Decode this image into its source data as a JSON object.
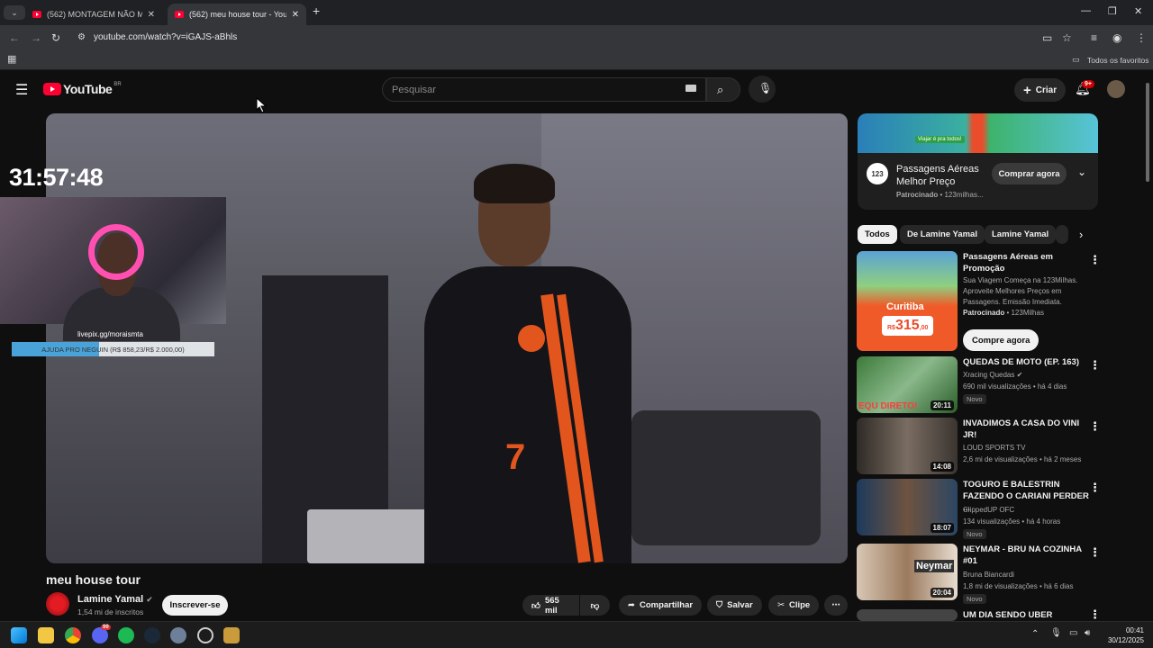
{
  "browser": {
    "tabs": [
      {
        "title": "(562) MONTAGEM NÃO ME CH..."
      },
      {
        "title": "(562) meu house tour - YouTube"
      }
    ],
    "url": "youtube.com/watch?v=iGAJS-aBhls",
    "bookmarks_label": "Todos os favoritos"
  },
  "header": {
    "logo_text": "YouTube",
    "country": "BR",
    "search_placeholder": "Pesquisar",
    "create_label": "Criar",
    "notif_count": "9+"
  },
  "overlay": {
    "timer": "31:57:48",
    "livepix": "livepix.gg/moraismta",
    "goal_text": "AJUDA PRO NEGUIN (R$ 858,23/R$ 2.000,00)",
    "goal_progress": 0.43
  },
  "video": {
    "title": "meu house tour",
    "channel": "Lamine Yamal",
    "subscribers": "1,54 mi de inscritos",
    "subscribe_label": "Inscrever-se",
    "likes": "565 mil",
    "share_label": "Compartilhar",
    "save_label": "Salvar",
    "clip_label": "Clipe"
  },
  "ad": {
    "banner_text": "Viajar é pra todos!",
    "logo": "123",
    "title": "Passagens Aéreas Melhor Preço",
    "sponsored": "Patrocinado",
    "sponsor": "123milhas...",
    "cta": "Comprar agora"
  },
  "chips": [
    "Todos",
    "De Lamine Yamal",
    "Lamine Yamal"
  ],
  "recommendations": [
    {
      "title": "Passagens Aéreas em Promoção",
      "meta": "Sua Viagem Começa na 123Milhas. Aproveite Melhores Preços em Passagens. Emissão Imediata.",
      "sponsored": "Patrocinado",
      "sponsor": "123Milhas",
      "cta": "Compre agora",
      "thumb_city": "Curitiba",
      "thumb_price": "315",
      "thumb_currency": "R$",
      "thumb_cents": ",00"
    },
    {
      "title": "QUEDAS DE MOTO (EP. 163)",
      "channel": "Xracing Quedas",
      "views": "690 mil visualizações",
      "age": "há 4 dias",
      "badge": "Novo",
      "duration": "20:11",
      "thumb_text": "EQU DIRETO!"
    },
    {
      "title": "INVADIMOS A CASA DO VINI JR!",
      "channel": "LOUD SPORTS TV",
      "views": "2,6 mi de visualizações",
      "age": "há 2 meses",
      "duration": "14:08"
    },
    {
      "title": "TOGURO E BALESTRIN FAZENDO O CARIANI PERDER ...",
      "channel": "ClippedUP OFC",
      "views": "134 visualizações",
      "age": "há 4 horas",
      "badge": "Novo",
      "duration": "18:07"
    },
    {
      "title": "NEYMAR - BRU NA COZINHA #01",
      "channel": "Bruna Biancardi",
      "views": "1,8 mi de visualizações",
      "age": "há 6 dias",
      "badge": "Novo",
      "duration": "20:04",
      "thumb_text": "Neymar"
    },
    {
      "title": "UM DIA SENDO UBER"
    }
  ],
  "taskbar": {
    "time": "00:41",
    "date": "30/12/2025",
    "discord_badge": "99"
  }
}
